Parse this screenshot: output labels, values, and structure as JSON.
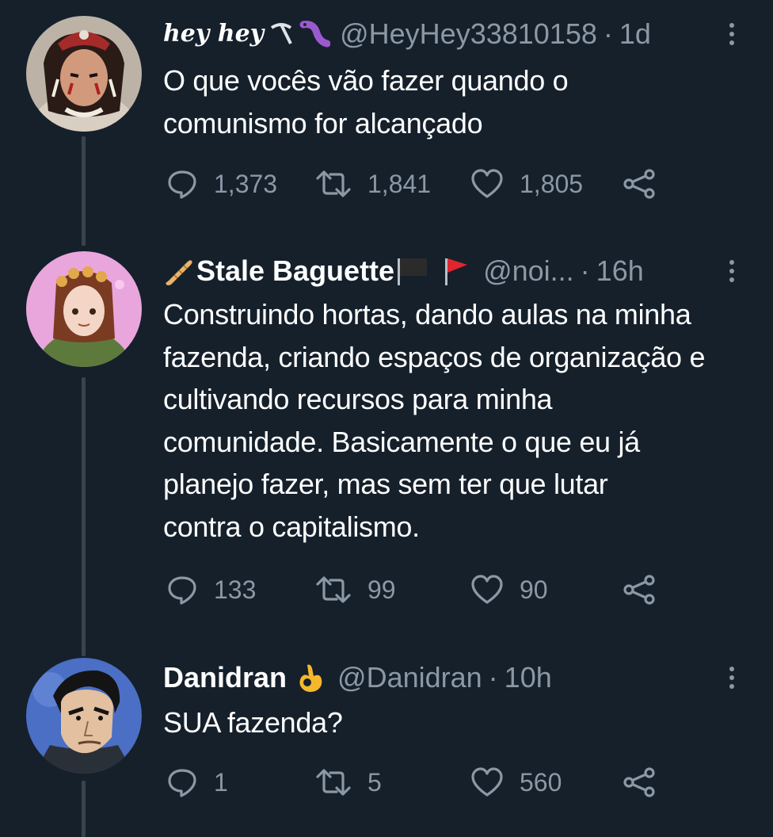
{
  "thread": {
    "tweets": [
      {
        "display_name": "hey hey",
        "name_emoji": [
          "pickaxe-emoji",
          "worm-emoji"
        ],
        "handle": "@HeyHey33810158",
        "separator": "·",
        "time": "1d",
        "text": "O que vocês vão fazer quando o\ncomunismo for alcançado",
        "replies": "1,373",
        "retweets": "1,841",
        "likes": "1,805"
      },
      {
        "display_name": "Stale Baguette",
        "name_emoji": [
          "baguette-emoji",
          "black-flag-emoji",
          "red-flag-emoji"
        ],
        "handle": "@noi...",
        "separator": "·",
        "time": "16h",
        "text": "Construindo hortas, dando aulas na minha\nfazenda, criando espaços de organização e\ncultivando recursos para minha\ncomunidade. Basicamente o que eu já\nplanejo fazer, mas sem ter que lutar\ncontra o capitalismo.",
        "replies": "133",
        "retweets": "99",
        "likes": "90"
      },
      {
        "display_name": "Danidran",
        "name_emoji": [
          "ok-hand-emoji"
        ],
        "handle": "@Danidran",
        "separator": "·",
        "time": "10h",
        "text": "SUA fazenda?",
        "replies": "1",
        "retweets": "5",
        "likes": "560"
      }
    ]
  },
  "colors": {
    "background": "#15202b",
    "text": "#ffffff",
    "secondary_text": "#8b98a5",
    "thread_line": "#38444d"
  }
}
